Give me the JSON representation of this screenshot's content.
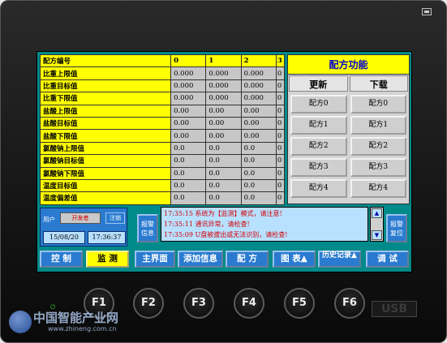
{
  "recipe_table": {
    "headers": [
      "配方编号",
      "0",
      "1",
      "2",
      "3"
    ],
    "rows": [
      {
        "label": "比重上限值",
        "values": [
          "0.000",
          "0.000",
          "0.000",
          "0"
        ]
      },
      {
        "label": "比重目标值",
        "values": [
          "0.000",
          "0.000",
          "0.000",
          "0"
        ]
      },
      {
        "label": "比重下限值",
        "values": [
          "0.000",
          "0.000",
          "0.000",
          "0"
        ]
      },
      {
        "label": "盐酸上限值",
        "values": [
          "0.00",
          "0.00",
          "0.00",
          "0"
        ]
      },
      {
        "label": "盐酸目标值",
        "values": [
          "0.00",
          "0.00",
          "0.00",
          "0"
        ]
      },
      {
        "label": "盐酸下限值",
        "values": [
          "0.00",
          "0.00",
          "0.00",
          "0"
        ]
      },
      {
        "label": "氯酸钠上限值",
        "values": [
          "0.0",
          "0.0",
          "0.0",
          "0"
        ]
      },
      {
        "label": "氯酸钠目标值",
        "values": [
          "0.0",
          "0.0",
          "0.0",
          "0"
        ]
      },
      {
        "label": "氯酸钠下限值",
        "values": [
          "0.0",
          "0.0",
          "0.0",
          "0"
        ]
      },
      {
        "label": "温度目标值",
        "values": [
          "0.0",
          "0.0",
          "0.0",
          "0"
        ]
      },
      {
        "label": "温度偏差值",
        "values": [
          "0.0",
          "0.0",
          "0.0",
          "0"
        ]
      }
    ]
  },
  "recipe_panel": {
    "title": "配方功能",
    "tab_update": "更新",
    "tab_download": "下载",
    "buttons": [
      "配方0",
      "配方0",
      "配方1",
      "配方1",
      "配方2",
      "配方2",
      "配方3",
      "配方3",
      "配方4",
      "配方4"
    ]
  },
  "user": {
    "label": "用户",
    "name": "开发者",
    "logout": "注销",
    "date": "15/08/20",
    "time": "17:36:37"
  },
  "alarm": {
    "info_button": "报警信息",
    "reset_button": "报警复位",
    "messages": [
      "17:35:15 系统为【监测】模式，请注意!",
      "17:35:11 通讯异常，请检查!",
      "17:35:09 U盘被拔出或无法识别，请检查!"
    ],
    "scroll_up": "▲",
    "scroll_down": "▼"
  },
  "nav": {
    "control": "控 制",
    "monitor": "监 测",
    "main": "主界面",
    "add_info": "添加信息",
    "recipe": "配 方",
    "chart": "图 表▲",
    "history": "历史记录▲",
    "debug": "调 试"
  },
  "device": {
    "fkeys": [
      "F1",
      "F2",
      "F3",
      "F4",
      "F5",
      "F6"
    ],
    "power_led": "⏻",
    "usb_label": "USB"
  },
  "watermark": {
    "title": "中国智能产业网",
    "url": "www.zhineng.com.cn"
  }
}
